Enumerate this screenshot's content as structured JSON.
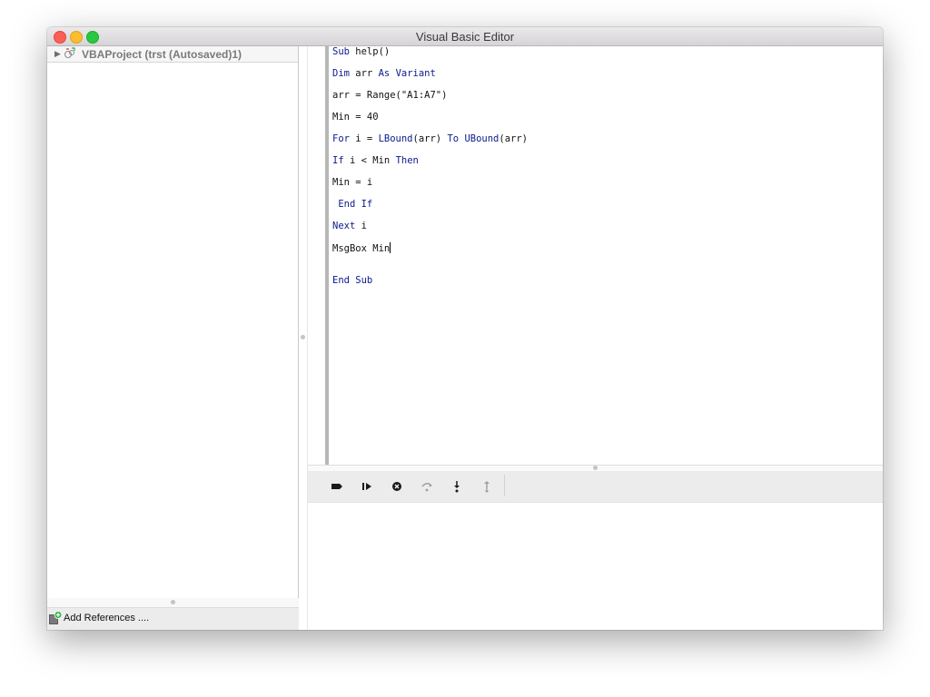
{
  "window": {
    "title": "Visual Basic Editor",
    "traffic_lights": [
      "close",
      "minimize",
      "maximize"
    ]
  },
  "project_tree": {
    "items": [
      {
        "label": "VBAProject (trst (Autosaved)1)",
        "expanded": false,
        "icon": "vba-project-icon"
      }
    ]
  },
  "references": {
    "label": "Add References ...."
  },
  "code_editor": {
    "lines": [
      {
        "text": "Sub help()"
      },
      {
        "text": "Dim arr As Variant"
      },
      {
        "text": "arr = Range(\"A1:A7\")"
      },
      {
        "text": "Min = 40"
      },
      {
        "text": "For i = LBound(arr) To UBound(arr)"
      },
      {
        "text": "If i < Min Then"
      },
      {
        "text": "Min = i"
      },
      {
        "text": " End If"
      },
      {
        "text": "Next i"
      },
      {
        "text": "MsgBox Min"
      },
      {
        "text": "End Sub"
      }
    ],
    "keyword_color": "#0a1a8c",
    "cursor_line": 10
  },
  "debug_toolbar": {
    "buttons": [
      {
        "name": "toggle-breakpoint",
        "icon": "breakpoint-icon",
        "enabled": true
      },
      {
        "name": "continue",
        "icon": "continue-icon",
        "enabled": true
      },
      {
        "name": "stop",
        "icon": "stop-icon",
        "enabled": true
      },
      {
        "name": "step-over",
        "icon": "step-over-icon",
        "enabled": false
      },
      {
        "name": "step-into",
        "icon": "step-into-icon",
        "enabled": true
      },
      {
        "name": "step-out",
        "icon": "step-out-icon",
        "enabled": false
      }
    ]
  },
  "immediate_window": {
    "text": ""
  }
}
